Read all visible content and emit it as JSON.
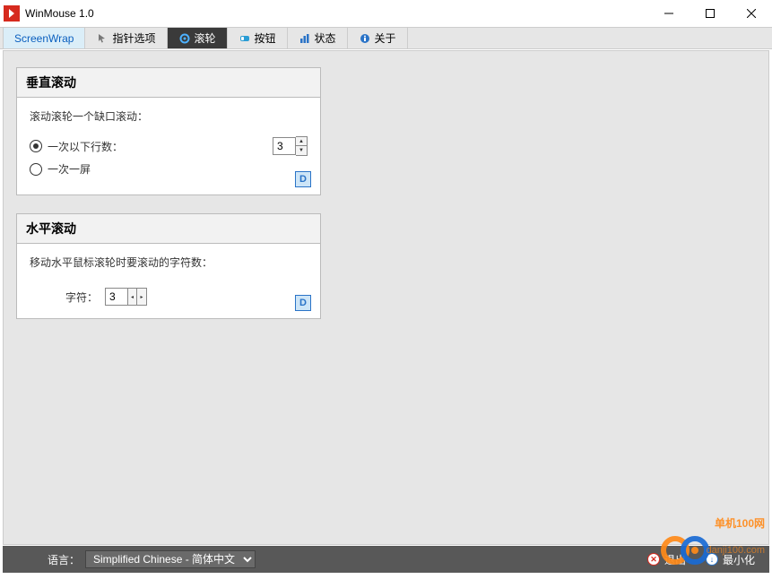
{
  "window": {
    "title": "WinMouse 1.0"
  },
  "tabs": [
    {
      "label": "ScreenWrap"
    },
    {
      "label": "指针选项"
    },
    {
      "label": "滚轮"
    },
    {
      "label": "按钮"
    },
    {
      "label": "状态"
    },
    {
      "label": "关于"
    }
  ],
  "vertical": {
    "title": "垂直滚动",
    "desc": "滚动滚轮一个缺口滚动：",
    "opt1": "一次以下行数：",
    "opt2": "一次一屏",
    "value": "3",
    "d": "D"
  },
  "horizontal": {
    "title": "水平滚动",
    "desc": "移动水平鼠标滚轮时要滚动的字符数：",
    "label": "字符：",
    "value": "3",
    "d": "D"
  },
  "bottom": {
    "lang_label": "语言：",
    "lang_value": "Simplified Chinese  -  简体中文",
    "exit": "退出",
    "minimize": "最小化"
  },
  "watermark": {
    "line1": "单机100网",
    "url": "danji100.com"
  }
}
